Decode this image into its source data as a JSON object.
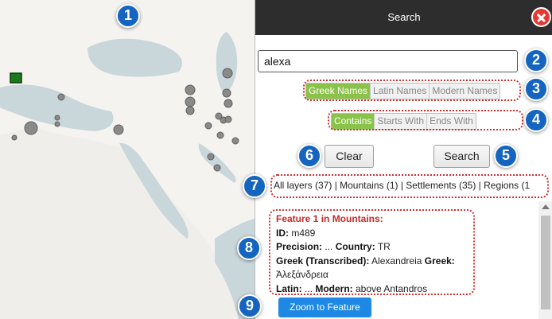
{
  "panel": {
    "title": "Search",
    "close_icon": "close-icon",
    "search_value": "alexa",
    "name_options": [
      "Greek Names",
      "Latin Names",
      "Modern Names"
    ],
    "match_options": [
      "Contains",
      "Starts With",
      "Ends With"
    ],
    "clear_label": "Clear",
    "search_label": "Search",
    "layers_text": "All layers (37) | Mountains (1) | Settlements (35) | Regions (1",
    "feature": {
      "title": "Feature 1 in Mountains:",
      "id_label": "ID:",
      "id_value": " m489",
      "precision_label": "Precision:",
      "precision_value": " ... ",
      "country_label": "Country:",
      "country_value": " TR",
      "greek_trans_label": "Greek (Transcribed):",
      "greek_trans_value": " Alexandreia ",
      "greek_label": "Greek:",
      "greek_value": "Ἀλεξάνδρεια",
      "latin_label": "Latin:",
      "latin_value": " ... ",
      "modern_label": "Modern:",
      "modern_value": " above Antandros"
    },
    "zoom_label": "Zoom to Feature"
  },
  "badges": [
    "1",
    "2",
    "3",
    "4",
    "5",
    "6",
    "7",
    "8",
    "9"
  ],
  "colors": {
    "active_green": "#8bc34a",
    "badge_blue": "#1565c0",
    "annotation_red": "#d32f2f",
    "zoom_blue": "#1e88e5",
    "feature_title_red": "#c62828"
  }
}
